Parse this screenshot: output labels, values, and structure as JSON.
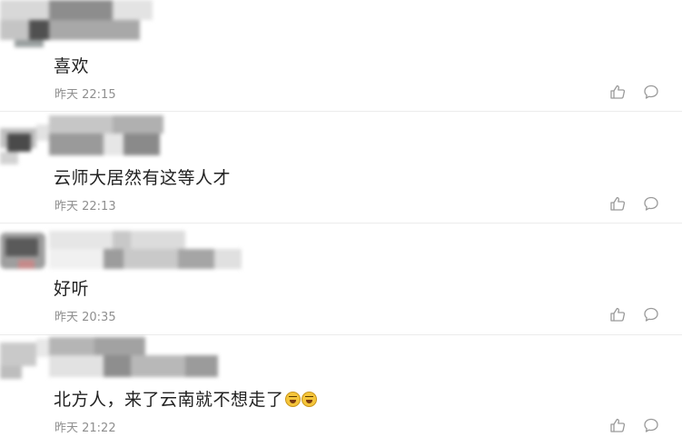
{
  "comments": [
    {
      "text": "喜欢",
      "time": "昨天 22:15",
      "emoji_count": 0
    },
    {
      "text": "云师大居然有这等人才",
      "time": "昨天 22:13",
      "emoji_count": 0
    },
    {
      "text": "好听",
      "time": "昨天 20:35",
      "emoji_count": 0
    },
    {
      "text": "北方人，来了云南就不想走了",
      "time": "昨天 21:22",
      "emoji_count": 2,
      "emoji_name": "laugh-cry-emoji"
    }
  ],
  "icons": {
    "like": "thumbs-up-icon",
    "reply": "comment-bubble-icon"
  },
  "colors": {
    "text": "#222222",
    "meta": "#8f8f8f",
    "icon": "#9a9a9a",
    "divider": "#ececec"
  }
}
